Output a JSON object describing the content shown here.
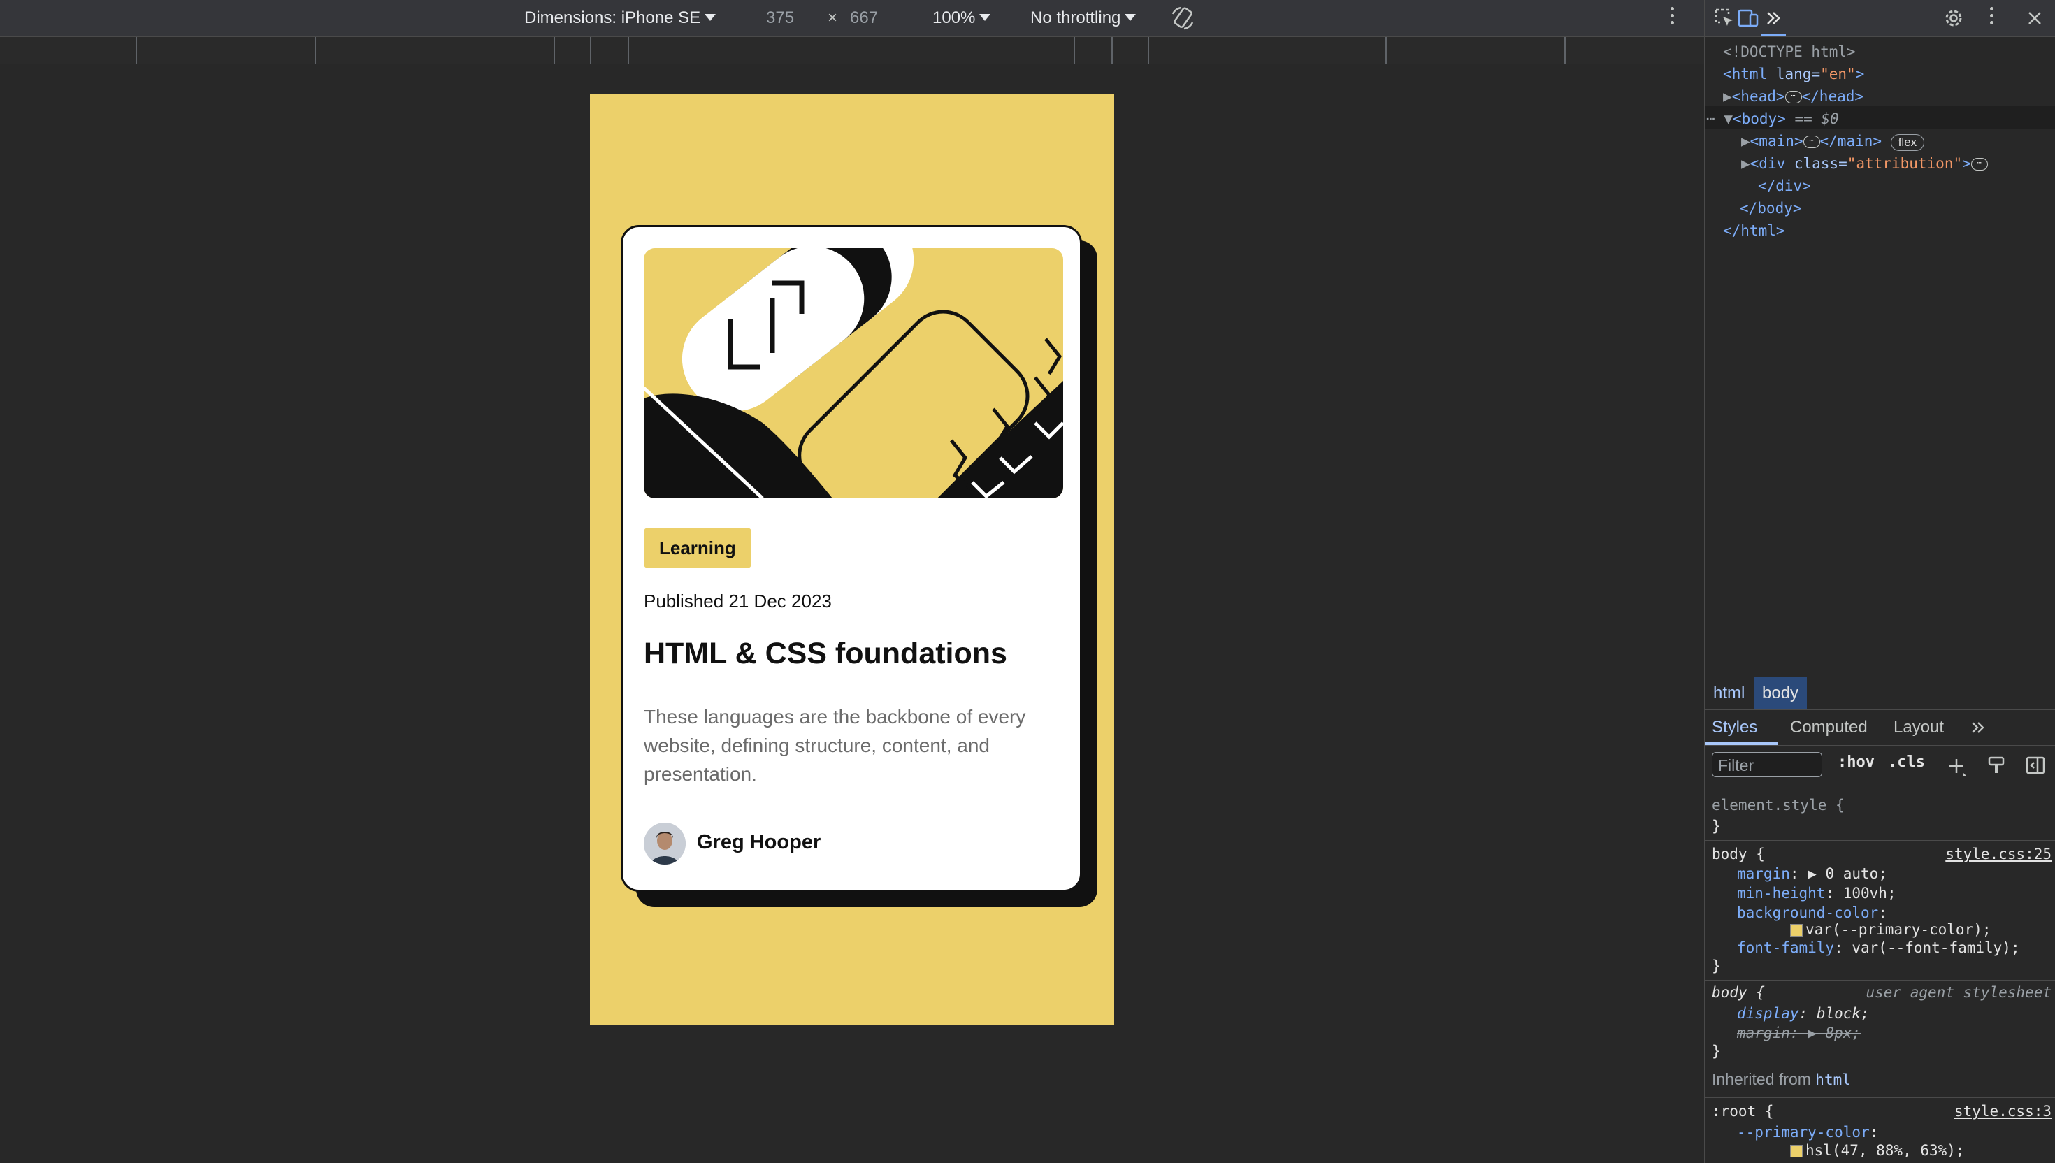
{
  "toolbar": {
    "dimensions_label": "Dimensions: iPhone SE",
    "width_value": "375",
    "times": "×",
    "height_value": "667",
    "zoom": "100%",
    "throttling": "No throttling"
  },
  "card": {
    "tag": "Learning",
    "published": "Published 21 Dec 2023",
    "title": "HTML & CSS foundations",
    "description": "These languages are the backbone of every website, defining structure, content, and presentation.",
    "author": "Greg Hooper"
  },
  "devtools": {
    "dom": {
      "doctype": "<!DOCTYPE html>",
      "html_open_tag": "<html",
      "lang_attr": "lang=",
      "lang_val": "\"en\"",
      "gt": ">",
      "head_open": "<head>",
      "head_close": "</head>",
      "body_open": "<body>",
      "body_eq": " == $0",
      "main_open": "<main>",
      "main_close": "</main>",
      "main_badge": "flex",
      "div_open": "<div",
      "class_attr": "class=",
      "class_val": "\"attribution\"",
      "div_close": "</div>",
      "body_close": "</body>",
      "html_close": "</html>",
      "ellipsis": "⋯"
    },
    "breadcrumbs": [
      "html",
      "body"
    ],
    "subtabs": [
      "Styles",
      "Computed",
      "Layout"
    ],
    "filter_placeholder": "Filter",
    "filter_buttons": [
      ":hov",
      ".cls"
    ],
    "styles": {
      "element_style": "element.style {",
      "close_brace": "}",
      "rule1_selector": "body {",
      "rule1_source": "style.css:25",
      "rule1_props": [
        {
          "name": "margin",
          "value": "▶ 0 auto;"
        },
        {
          "name": "min-height",
          "value": "100vh;"
        },
        {
          "name": "background-color",
          "value": ""
        },
        {
          "name": "",
          "value": "var(--primary-color);"
        },
        {
          "name": "font-family",
          "value": "var(--font-family);"
        }
      ],
      "rule2_selector": "body {",
      "rule2_source": "user agent stylesheet",
      "rule2_props": [
        {
          "name": "display",
          "value": "block;"
        },
        {
          "name": "margin",
          "value": "▶ 8px;"
        }
      ],
      "inherited_label": "Inherited from",
      "inherited_from": "html",
      "root_selector": ":root {",
      "root_source": "style.css:3",
      "root_prop_name": "--primary-color",
      "root_prop_value": "hsl(47, 88%, 63%);"
    }
  },
  "colors": {
    "primary": "#ecd06a",
    "card": "#ffffff",
    "ink": "#111111"
  }
}
